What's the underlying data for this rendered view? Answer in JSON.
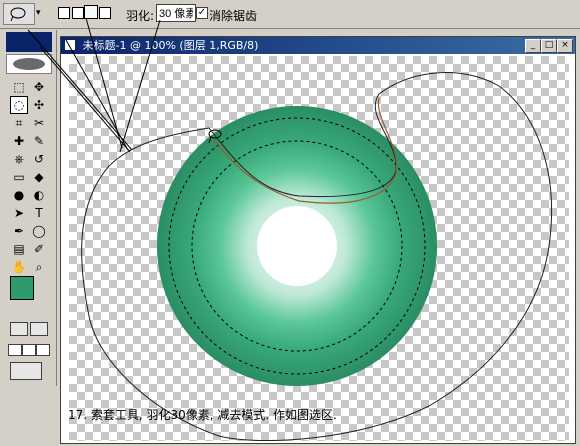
{
  "options_bar": {
    "feather_label": "羽化:",
    "feather_value": "30 像素",
    "anti_alias_label": "消除锯齿",
    "anti_alias_checked": true
  },
  "document": {
    "title": "未标题-1 @ 100% (图层 1,RGB/8)",
    "min_symbol": "_",
    "max_symbol": "□",
    "close_symbol": "×"
  },
  "caption": "17. 索套工具, 羽化30像素, 减去模式. 作如图选区.",
  "colors": {
    "accent_ring": "#3aa87a",
    "foreground": "#2f9a6e",
    "background": "#ffffff"
  },
  "tools": [
    "marquee-icon",
    "move-icon",
    "lasso-icon",
    "magic-wand-icon",
    "crop-icon",
    "slice-icon",
    "healing-icon",
    "brush-icon",
    "clone-stamp-icon",
    "history-brush-icon",
    "eraser-icon",
    "bucket-icon",
    "blur-icon",
    "dodge-icon",
    "path-select-icon",
    "type-icon",
    "pen-icon",
    "shape-icon",
    "notes-icon",
    "eyedropper-icon",
    "hand-icon",
    "zoom-icon"
  ]
}
